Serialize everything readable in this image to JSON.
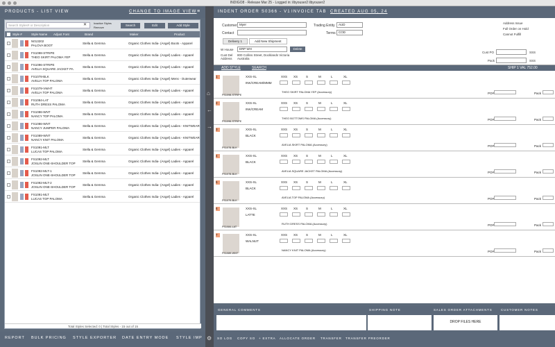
{
  "window": {
    "title": "INDIGO8 - Release Mar 25 - Logged in: ilbyouser2 ilbyouser2"
  },
  "left": {
    "title": "PRODUCTS - LIST VIEW",
    "switch": "CHANGE TO IMAGE VIEW",
    "search_placeholder": "Search Styles# or Description",
    "inactive_label": "Inactive Styles",
    "remove_label": "Remove",
    "search_btn": "Search",
    "edit_btn": "Edit",
    "add_btn": "Add Style",
    "headers": [
      "Style #",
      "Style Name",
      "Adjust Font",
      "Brand",
      "Maker",
      "Product"
    ],
    "rows": [
      {
        "code": "N013202",
        "name": "PALOVA BOOT",
        "brand": "Stella & Gemma",
        "maker": "Organic Clothes India- (Angel) Boots - Apparel"
      },
      {
        "code": "FS1098-STRIPE",
        "name": "THEO SKIRT PALOMA YEP",
        "brand": "Stella & Gemma",
        "maker": "Organic Clothes India- (Angel) Ladies - Apparel"
      },
      {
        "code": "FS1096-STRIPE",
        "name": "AVELIA SQUARE JACKET PA",
        "brand": "Stella & Gemma",
        "maker": "Organic Clothes India- (Angel) Ladies - Apparel"
      },
      {
        "code": "FS1078-BLK",
        "name": "AVELIA TOP PALOMA",
        "brand": "Stella & Gemma",
        "maker": "Organic Clothes India- (Angel) Mens - Outerwear"
      },
      {
        "code": "FS1079-VWHT",
        "name": "AVELIA TOP PALOMA",
        "brand": "Stella & Gemma",
        "maker": "Organic Clothes India- (Angel) Ladies - Apparel"
      },
      {
        "code": "FS1084-LAT",
        "name": "RUTH DRESS PALOMA",
        "brand": "Stella & Gemma",
        "maker": "Organic Clothes India- (Angel) Ladies - Apparel"
      },
      {
        "code": "FS1086-WNT",
        "name": "NANCY TOP PALOMA",
        "brand": "Stella & Gemma",
        "maker": "Organic Clothes India- (Angel) Ladies - Apparel"
      },
      {
        "code": "FS1086-WNT",
        "name": "NANCY JUMPER PALOMA",
        "brand": "Stella & Gemma",
        "maker": "Organic Clothes India- (Angel) Ladies - KNITWEAR"
      },
      {
        "code": "FS1089-WNT",
        "name": "NANCY KNIT PALOMA",
        "brand": "Stella & Gemma",
        "maker": "Organic Clothes India- (Angel) Ladies - KNITWEAR"
      },
      {
        "code": "FS1091-MLT",
        "name": "LUCAS TOP PALOMA",
        "brand": "Stella & Gemma",
        "maker": "Organic Clothes India- (Angel) Ladies - Apparel"
      },
      {
        "code": "FS1092-MLT",
        "name": "JOSLIN ONE-SHOULDER TOP",
        "brand": "Stella & Gemma",
        "maker": "Organic Clothes India- (Angel) Ladies - Apparel"
      },
      {
        "code": "FS1092-MLT-1",
        "name": "JOSLIN ONE-SHOULDER TOP",
        "brand": "Stella & Gemma",
        "maker": "Organic Clothes India- (Angel) Ladies - Apparel"
      },
      {
        "code": "FS1092-MLT-2",
        "name": "JOSLIN ONE-SHOULDER TOP",
        "brand": "Stella & Gemma",
        "maker": "Organic Clothes India- (Angel) Ladies - Apparel"
      },
      {
        "code": "FS1091-MLT",
        "name": "LUCAS TOP PALOMA",
        "brand": "Stella & Gemma",
        "maker": "Organic Clothes India- (Angel) Ladies - Apparel"
      }
    ],
    "footer": "Total Styles Selected: 0 | Total Styles - 15 out of 15",
    "bottom": [
      "REPORT",
      "BULK PRICING",
      "STYLE EXPORTER",
      "DATE ENTRY MODE",
      "STYLE IMP"
    ]
  },
  "right": {
    "title": "INDENT ORDER S0366 - V1",
    "tab": "INVOICE TAB",
    "created": "CREATED AUG 05, 24",
    "customer_label": "Customer",
    "customer": "Myer",
    "contact_label": "Contact",
    "trading_label": "Trading Entity",
    "trading": "AUD",
    "terms_label": "Terms",
    "terms": "COD",
    "opts": [
      "Address Issue",
      "Full Order on Hold",
      "Cannot Fulfill"
    ],
    "tabs": [
      "Delivery 1",
      "Add New Shipment"
    ],
    "whouse_label": "W House",
    "whouse": "ERP WH",
    "delete_btn": "Delete",
    "cust_del_label": "Cust Del Address",
    "address": "800 Collins Street, Docklands Victoria Australia",
    "cust_po": "Cust PO",
    "pack": "Pack",
    "sss": "SSS",
    "add_style": "ADD STYLE",
    "search": "SEARCH",
    "ship_total": "SHIP 1 VAL 752.00",
    "sizes": [
      "XXS",
      "XS",
      "S",
      "M",
      "L",
      "XL"
    ],
    "items": [
      {
        "n": "1",
        "code": "FS1098-STRIPE",
        "range": "XXS-XL",
        "color": "INK/CREAM/MMM",
        "desc": "THEO SKIRT PALOMA YEP (Accessory)"
      },
      {
        "n": "2",
        "code": "FS1096-STRIPE",
        "range": "XXS-XL",
        "color": "INK/CREAM",
        "desc": "THEO BOTTOMS PALOMA (Accessory)"
      },
      {
        "n": "3",
        "code": "FS1078-BLK",
        "range": "XXS-XL",
        "color": "BLACK",
        "desc": "AVELIA SKIRT PALOMA (Accessory)"
      },
      {
        "n": "4",
        "code": "FS1078-BLK",
        "range": "XXS-XL",
        "color": "BLACK",
        "desc": "AVELIA SQUARE JACKET PALOMA (Accessory)"
      },
      {
        "n": "5",
        "code": "FS1079-BLK",
        "range": "XXS-XL",
        "color": "BLACK",
        "desc": "AVELIA TOP PALOMA (Accessory)"
      },
      {
        "n": "6",
        "code": "FS1084-LAT",
        "range": "XXS-XL",
        "color": "LATTE",
        "desc": "RUTH DRESS PALOMA (Accessory)"
      },
      {
        "n": "7",
        "code": "FS1089-WNT",
        "range": "XXS-XL",
        "color": "WALNUT",
        "desc": "NANCY KNIT PALOMA (Accessory)"
      }
    ],
    "po": "PO#",
    "bottom_headers": [
      "GENERAL COMMENTS",
      "SHIPPING NOTE",
      "SALES ORDER ATTACHMENTS",
      "CUSTOMER NOTES"
    ],
    "drop": "DROP FILES HERE",
    "bottom": [
      "SO LOG",
      "COPY SO",
      "+ EXTRA",
      "ALLOCATE ORDER",
      "TRANSFER",
      "TRANSFER PREORDER"
    ]
  }
}
